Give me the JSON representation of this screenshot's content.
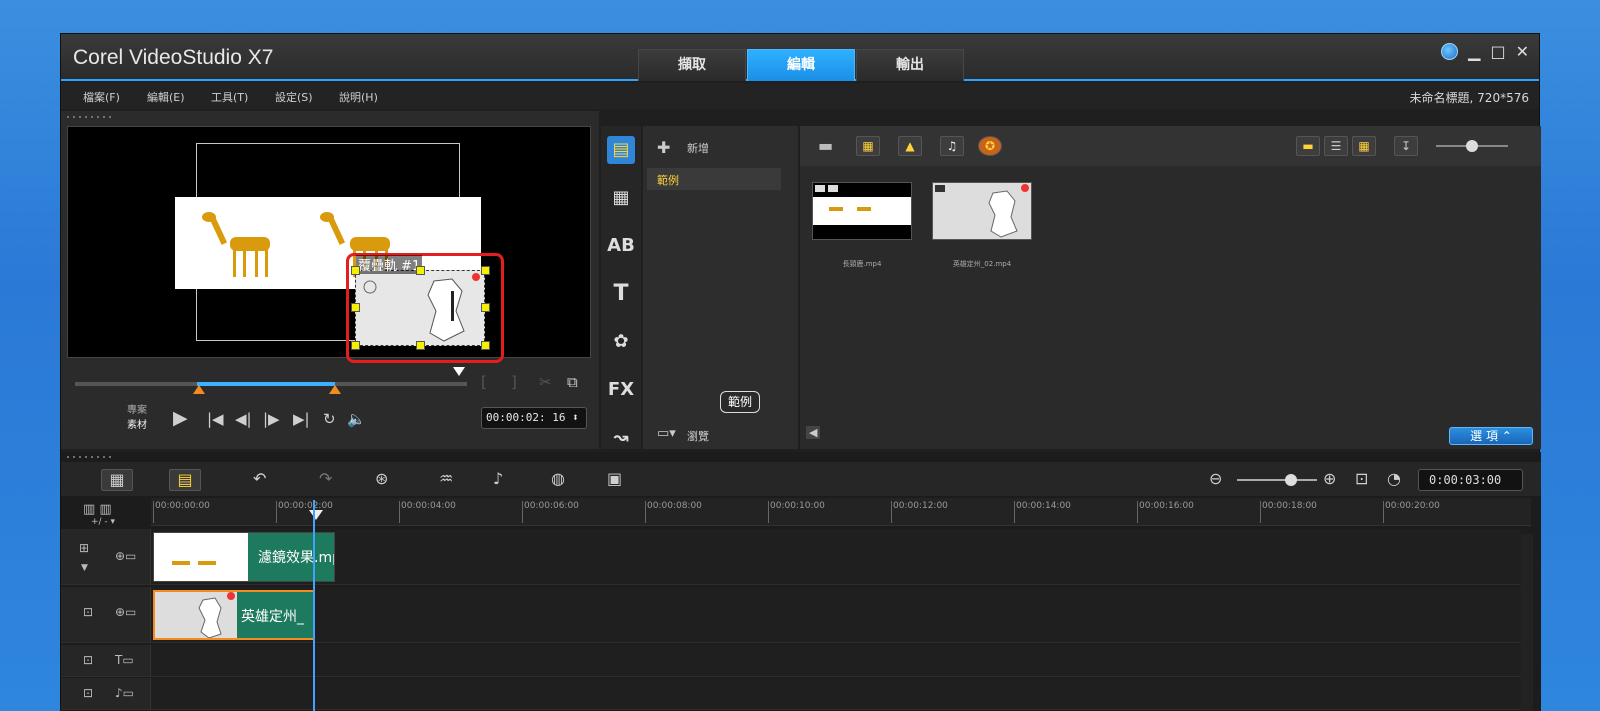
{
  "window": {
    "title": "Corel VideoStudio X7",
    "tabs": [
      "擷取",
      "編輯",
      "輸出"
    ],
    "active_tab": "編輯",
    "controls": [
      "globe-icon",
      "minimize-icon",
      "maximize-icon",
      "close-icon"
    ]
  },
  "menu": {
    "items": [
      "檔案(F)",
      "編輯(E)",
      "工具(T)",
      "設定(S)",
      "說明(H)"
    ],
    "project_info": "未命名標題, 720*576"
  },
  "preview": {
    "overlay_label": "覆疊軌 #1",
    "mode_project": "專案",
    "mode_clip": "素材",
    "timecode": "00:00:02: 16"
  },
  "library": {
    "add_label": "新增",
    "folder_selected": "範例",
    "browse_label": "瀏覽",
    "tooltip": "範例",
    "options_label": "選 項",
    "thumbnails": [
      {
        "name": "長頸鹿.mp4"
      },
      {
        "name": "英雄定州_02.mp4"
      }
    ],
    "side_icons": [
      "media-icon",
      "instant-project-icon",
      "transition-icon",
      "title-icon",
      "graphic-icon",
      "filter-icon",
      "path-icon"
    ]
  },
  "timeline": {
    "timecode": "0:00:03:00",
    "ruler": [
      "00:00:00:00",
      "00:00:02:00",
      "00:00:04:00",
      "00:00:06:00",
      "00:00:08:00",
      "00:00:10:00",
      "00:00:12:00",
      "00:00:14:00",
      "00:00:16:00",
      "00:00:18:00",
      "00:00:20:00"
    ],
    "clips": [
      {
        "track": "video",
        "label": "濾鏡效果.mp"
      },
      {
        "track": "overlay",
        "label": "英雄定州_"
      }
    ],
    "track_plusminus": "+/ - ▾"
  }
}
